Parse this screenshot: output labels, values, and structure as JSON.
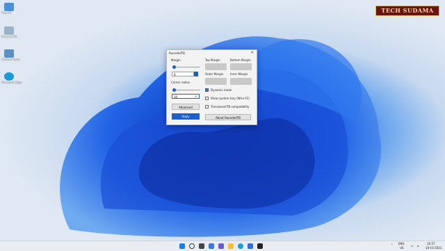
{
  "watermark": "TECH SUDAMA",
  "desktop_icons": [
    {
      "label": "This PC",
      "icon": "pc-icon",
      "color": "#4a90d9"
    },
    {
      "label": "Recycle Bin",
      "icon": "recycle-bin-icon",
      "color": "#9ab3c7"
    },
    {
      "label": "Control Panel",
      "icon": "control-panel-icon",
      "color": "#5c8fc2"
    },
    {
      "label": "Microsoft Edge",
      "icon": "edge-icon",
      "color": "#1e9bd7"
    }
  ],
  "dialog": {
    "title": "RoundedTB",
    "close": "✕",
    "margin_label": "Margin",
    "margin_value": "0",
    "corner_radius_label": "Corner radius",
    "corner_radius_value": "10",
    "top_margin_label": "Top Margin",
    "bottom_margin_label": "Bottom Margin",
    "outer_margin_label": "Outer Margin",
    "inner_margin_label": "Inner Margin",
    "dynamic_mode_label": "Dynamic mode",
    "dynamic_mode_checked": true,
    "show_tray_label": "Show system tray (Win+F2)",
    "show_tray_checked": false,
    "translucent_label": "TranslucentTB compatibility",
    "translucent_checked": false,
    "advanced_label": "Advanced",
    "apply_label": "Apply",
    "about_label": "About RoundedTB"
  },
  "taskbar": {
    "icons": [
      "windows-start-icon",
      "search-icon",
      "task-view-icon",
      "widgets-icon",
      "chat-icon",
      "file-explorer-icon",
      "edge-icon",
      "store-icon",
      "terminal-icon"
    ],
    "language": "ENG",
    "region": "US",
    "time": "16:57",
    "date": "18-10-2021",
    "accent": "#1a5fd0"
  }
}
